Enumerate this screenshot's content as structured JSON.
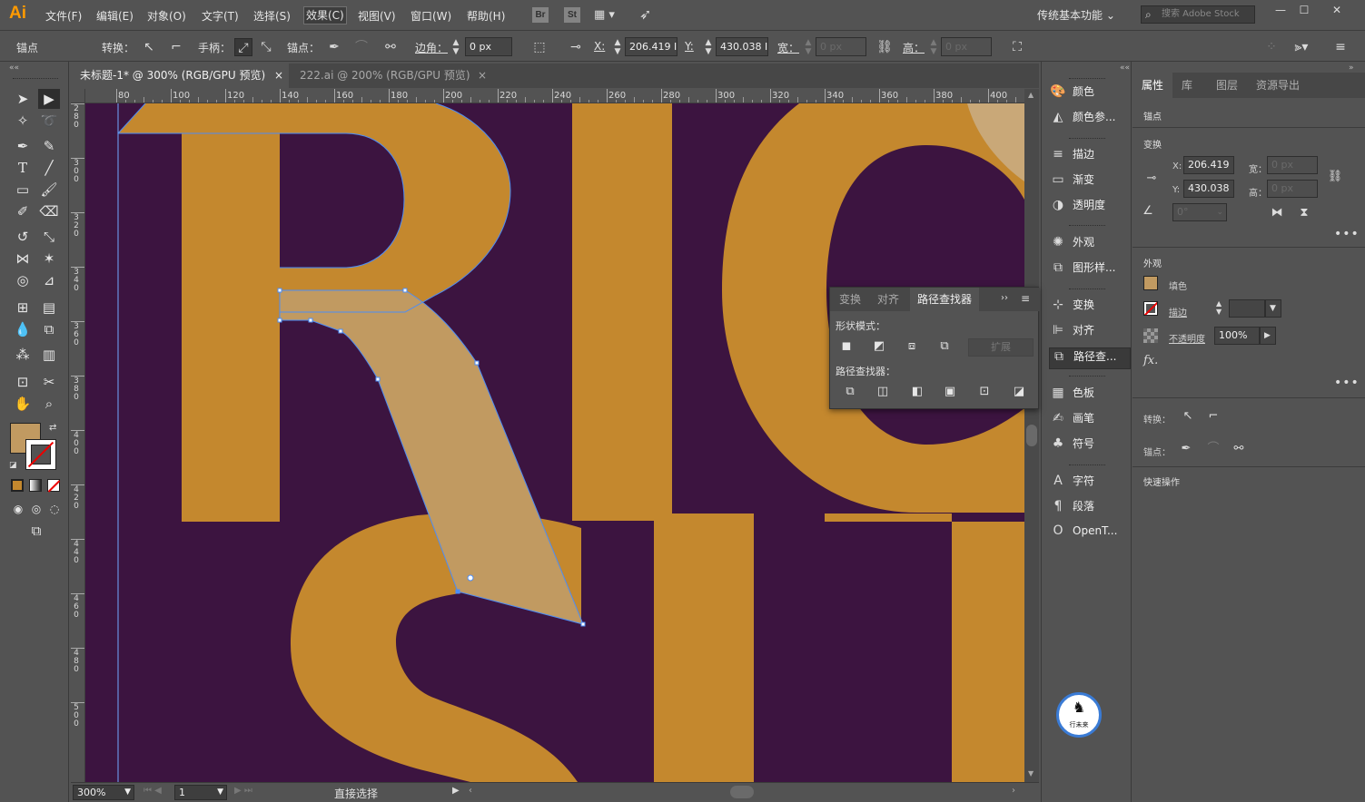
{
  "app": {
    "logo": "Ai",
    "menus": [
      "文件(F)",
      "编辑(E)",
      "对象(O)",
      "文字(T)",
      "选择(S)",
      "效果(C)",
      "视图(V)",
      "窗口(W)",
      "帮助(H)"
    ],
    "active_menu": "效果(C)",
    "bridge_badge": "Br",
    "stock_badge": "St",
    "workspace": "传统基本功能",
    "search_placeholder": "搜索 Adobe Stock",
    "colors": {
      "accent": "#ff9a00",
      "shape_fill": "#c4882e",
      "canvas_bg": "#3c1440",
      "selection": "#4c8df6",
      "selected_fill": "#c19a61"
    }
  },
  "control_bar": {
    "mode_label": "锚点",
    "convert_label": "转换：",
    "handles_label": "手柄：",
    "anchor_label": "锚点：",
    "corner_label": "边角：",
    "corner_value": "0 px",
    "x_label": "X:",
    "x_value": "206.419 I",
    "y_label": "Y:",
    "y_value": "430.038 I",
    "w_label": "宽：",
    "w_value": "0 px",
    "h_label": "高：",
    "h_value": "0 px"
  },
  "tabs": [
    {
      "label": "未标题-1* @ 300% (RGB/GPU 预览)",
      "close": "×",
      "active": true
    },
    {
      "label": "222.ai @ 200% (RGB/GPU 预览)",
      "close": "×",
      "active": false
    }
  ],
  "ruler": {
    "h_ticks": [
      "80",
      "100",
      "120",
      "140",
      "160",
      "180",
      "200",
      "220",
      "240",
      "260",
      "280",
      "300",
      "320",
      "340",
      "360",
      "380",
      "400"
    ],
    "v_ticks": [
      "280",
      "300",
      "320",
      "340",
      "360",
      "380",
      "400",
      "420",
      "440",
      "460",
      "480",
      "500"
    ]
  },
  "status": {
    "zoom": "300%",
    "page": "1",
    "tool_name": "直接选择"
  },
  "dock": {
    "items": [
      "颜色",
      "颜色参...",
      "描边",
      "渐变",
      "透明度",
      "外观",
      "图形样...",
      "变换",
      "对齐",
      "路径查...",
      "色板",
      "画笔",
      "符号",
      "字符",
      "段落",
      "OpenT..."
    ],
    "selected": "路径查..."
  },
  "pathfinder_panel": {
    "tabs": [
      "变换",
      "对齐",
      "路径查找器"
    ],
    "active_tab": "路径查找器",
    "shape_modes_label": "形状模式：",
    "expand_label": "扩展",
    "pathfinders_label": "路径查找器："
  },
  "properties": {
    "tabs": [
      "属性",
      "库",
      "图层",
      "资源导出"
    ],
    "active_tab": "属性",
    "selection_type": "锚点",
    "transform_title": "变换",
    "x_label": "X:",
    "x_value": "206.419",
    "y_label": "Y:",
    "y_value": "430.038",
    "w_label": "宽：",
    "w_value": "0 px",
    "h_label": "高：",
    "h_value": "0 px",
    "angle_value": "0°",
    "appearance_title": "外观",
    "fill_label": "填色",
    "stroke_label": "描边",
    "opacity_label": "不透明度",
    "opacity_value": "100%",
    "fx_label": "fx.",
    "convert_label": "转换：",
    "anchor_label": "锚点：",
    "quick_actions_label": "快速操作"
  },
  "watermark": {
    "text": "行未来"
  }
}
